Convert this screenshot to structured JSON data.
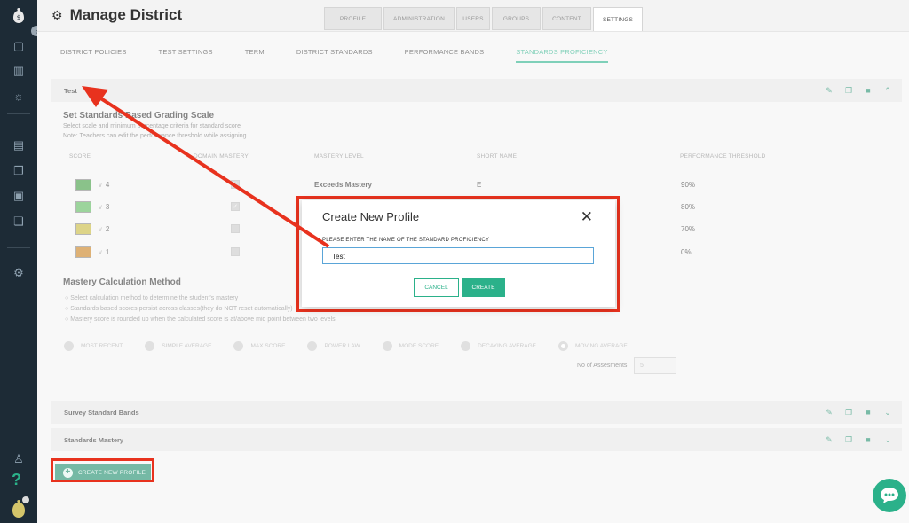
{
  "header": {
    "title": "Manage District",
    "tabs": [
      "PROFILE",
      "ADMINISTRATION",
      "USERS",
      "GROUPS",
      "CONTENT",
      "SETTINGS"
    ],
    "active_tab": "SETTINGS"
  },
  "subtabs": [
    "DISTRICT POLICIES",
    "TEST SETTINGS",
    "TERM",
    "DISTRICT STANDARDS",
    "PERFORMANCE BANDS",
    "STANDARDS PROFICIENCY"
  ],
  "active_subtab": "STANDARDS PROFICIENCY",
  "profile_panel": {
    "title": "Test"
  },
  "grading": {
    "title": "Set Standards Based Grading Scale",
    "desc1": "Select scale and minimum percentage criteria for standard score",
    "desc2": "Note: Teachers can edit the performance threshold while assigning",
    "headers": [
      "SCORE",
      "DOMAIN MASTERY",
      "MASTERY LEVEL",
      "SHORT NAME",
      "PERFORMANCE THRESHOLD"
    ],
    "rows": [
      {
        "score": "4",
        "color": "#3d9a3c",
        "checked": true,
        "mastery": "Exceeds Mastery",
        "short": "E",
        "threshold": "90%"
      },
      {
        "score": "3",
        "color": "#5ab85a",
        "checked": true,
        "mastery": "",
        "short": "",
        "threshold": "80%"
      },
      {
        "score": "2",
        "color": "#c6b73a",
        "checked": false,
        "mastery": "",
        "short": "",
        "threshold": "70%"
      },
      {
        "score": "1",
        "color": "#c87d1a",
        "checked": false,
        "mastery": "",
        "short": "",
        "threshold": "0%"
      }
    ]
  },
  "mastery_calc": {
    "title": "Mastery Calculation Method",
    "bullets": [
      "Select calculation method to determine the student's mastery",
      "Standards based scores persist across classes(they do NOT reset automatically)",
      "Mastery score is rounded up when the calculated score is at/above mid point between two levels"
    ],
    "methods": [
      "MOST RECENT",
      "SIMPLE AVERAGE",
      "MAX SCORE",
      "POWER LAW",
      "MODE SCORE",
      "DECAYING AVERAGE",
      "MOVING AVERAGE"
    ],
    "selected": "MOVING AVERAGE",
    "assessments_label": "No of Assesments",
    "assessments_value": "5"
  },
  "other_profiles": [
    "Survey Standard Bands",
    "Standards Mastery"
  ],
  "create_button": "CREATE NEW PROFILE",
  "modal": {
    "title": "Create New Profile",
    "label": "PLEASE ENTER THE NAME OF THE STANDARD PROFICIENCY",
    "input_value": "Test",
    "cancel": "CANCEL",
    "create": "CREATE"
  },
  "colors": {
    "accent": "#2bb18a",
    "sidebar": "#1d2b36",
    "annotation": "#e8321e"
  }
}
